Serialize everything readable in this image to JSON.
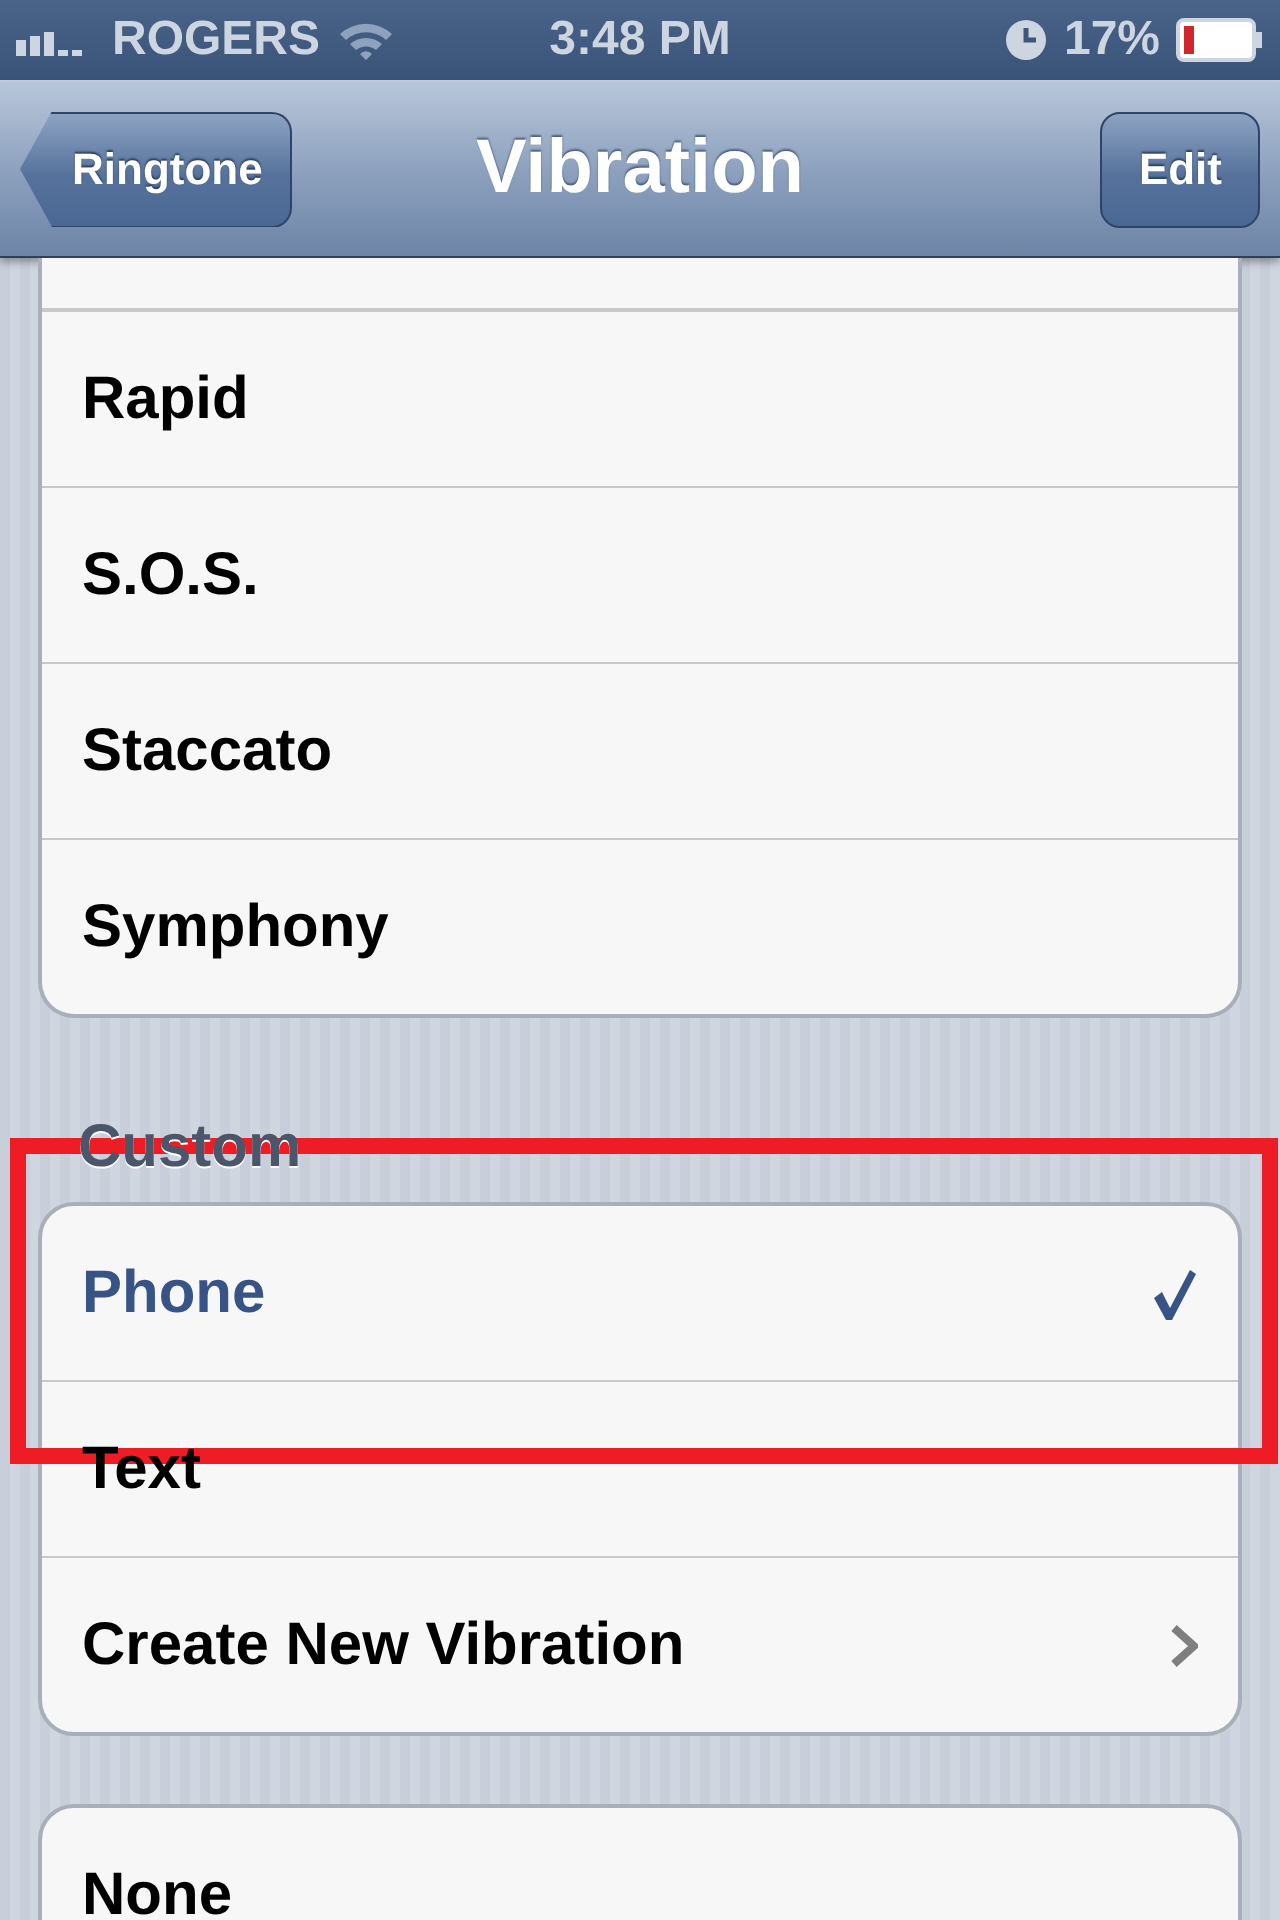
{
  "status_bar": {
    "carrier": "ROGERS",
    "time": "3:48 PM",
    "battery": "17%"
  },
  "nav_bar": {
    "back": "Ringtone",
    "title": "Vibration",
    "action": "Edit"
  },
  "groups": [
    {
      "items": [
        {
          "label": "Rapid",
          "kind": "plain",
          "selected": false
        },
        {
          "label": "S.O.S.",
          "kind": "plain",
          "selected": false
        },
        {
          "label": "Staccato",
          "kind": "plain",
          "selected": false
        },
        {
          "label": "Symphony",
          "kind": "plain",
          "selected": false
        }
      ]
    },
    {
      "header": "Custom",
      "items": [
        {
          "label": "Phone",
          "kind": "check",
          "selected": true
        },
        {
          "label": "Text",
          "kind": "check",
          "selected": false
        },
        {
          "label": "Create New Vibration",
          "kind": "disclosure",
          "selected": false
        }
      ]
    },
    {
      "items": [
        {
          "label": "None",
          "kind": "check",
          "selected": false
        }
      ]
    }
  ]
}
